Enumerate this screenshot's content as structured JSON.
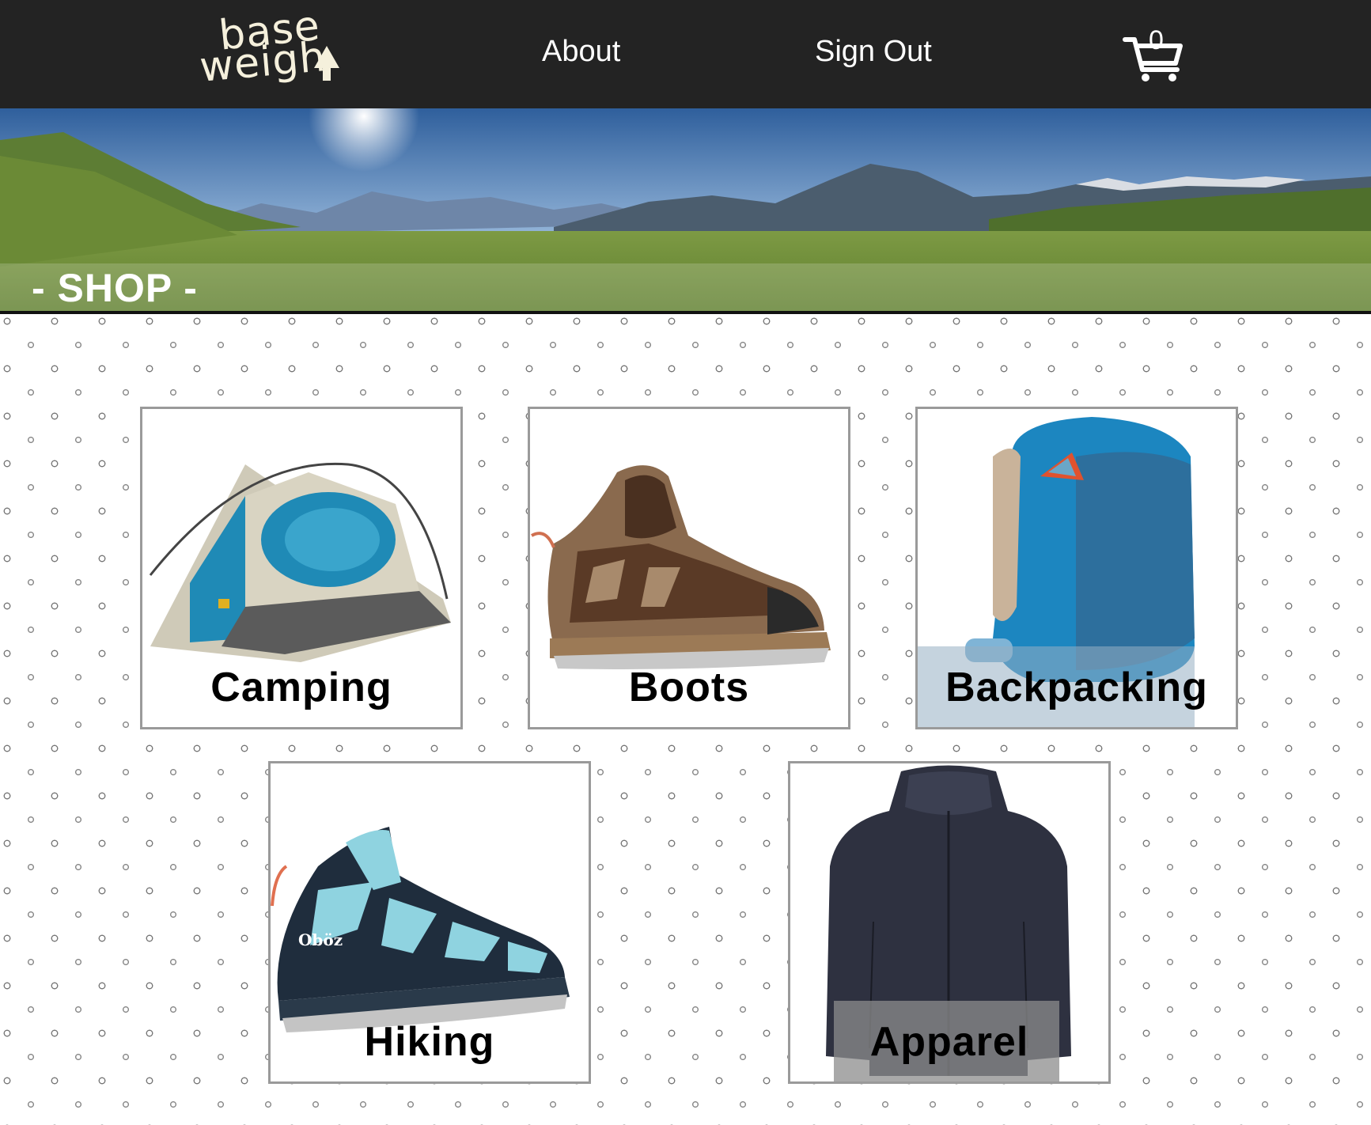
{
  "nav": {
    "logo_line1": "base",
    "logo_line2": "weigh",
    "about": "About",
    "sign_out": "Sign Out",
    "cart_count": "0"
  },
  "hero": {
    "title": "- SHOP -"
  },
  "categories": [
    {
      "label": "Camping",
      "icon": "tent-image"
    },
    {
      "label": "Boots",
      "icon": "boot-image"
    },
    {
      "label": "Backpacking",
      "icon": "backpack-image"
    },
    {
      "label": "Hiking",
      "icon": "hiking-boot-image"
    },
    {
      "label": "Apparel",
      "icon": "jacket-image"
    }
  ],
  "colors": {
    "nav_bg": "#232323",
    "logo": "#f5f0dc",
    "card_border": "#9a9a9a"
  }
}
